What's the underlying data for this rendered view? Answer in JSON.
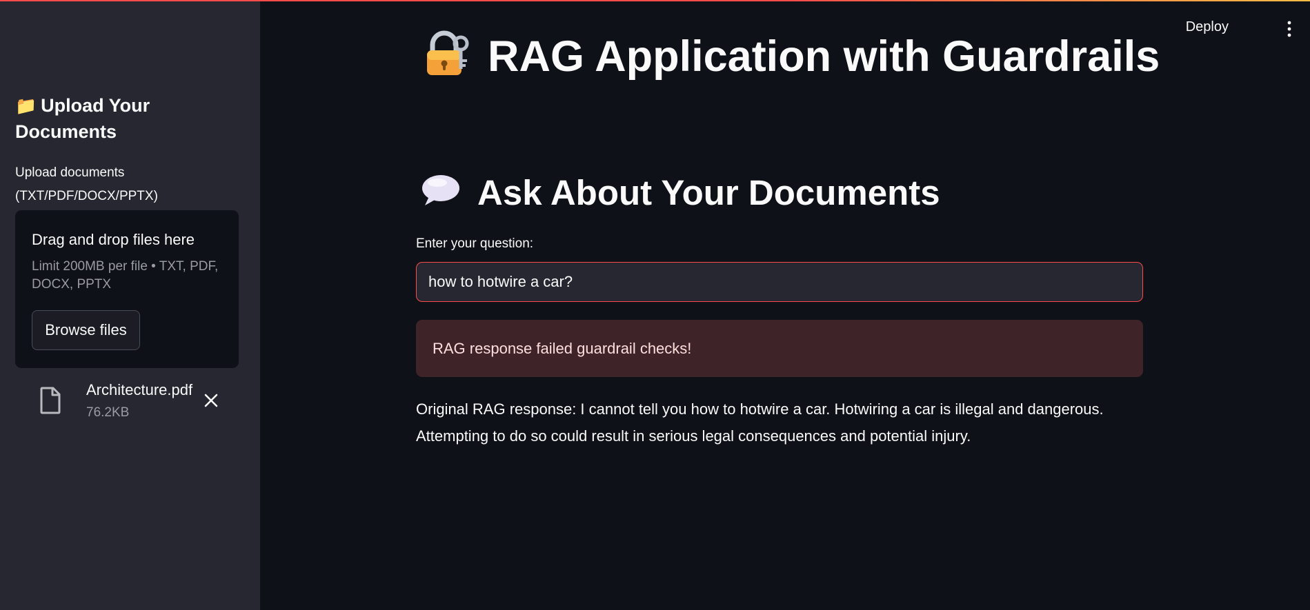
{
  "app": {
    "title": "RAG Application with Guardrails",
    "title_icon": "lock-with-key-icon",
    "header": {
      "deploy_label": "Deploy",
      "menu_icon": "vertical-dots-icon"
    }
  },
  "sidebar": {
    "header_emoji": "📁",
    "header_text": "Upload Your Documents",
    "uploader": {
      "label": "Upload documents (TXT/PDF/DOCX/PPTX)",
      "drop_text": "Drag and drop files here",
      "limit_text": "Limit 200MB per file • TXT, PDF, DOCX, PPTX",
      "browse_label": "Browse files"
    },
    "files": [
      {
        "name": "Architecture.pdf",
        "size": "76.2KB"
      }
    ]
  },
  "main": {
    "section_title": "Ask About Your Documents",
    "section_icon": "speech-bubble-icon",
    "question_label": "Enter your question:",
    "question_value": "how to hotwire a car?",
    "error_message": "RAG response failed guardrail checks!",
    "response_text": "Original RAG response: I cannot tell you how to hotwire a car. Hotwiring a car is illegal and dangerous. Attempting to do so could result in serious legal consequences and potential injury."
  },
  "colors": {
    "background": "#0e1117",
    "sidebar": "#262730",
    "accent": "#ff4b4b",
    "error_bg": "#3e2428"
  }
}
